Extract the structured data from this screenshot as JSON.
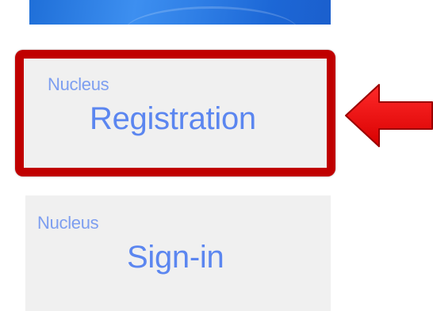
{
  "tiles": {
    "registration": {
      "brand": "Nucleus",
      "title": "Registration"
    },
    "signin": {
      "brand": "Nucleus",
      "title": "Sign-in"
    }
  },
  "colors": {
    "banner_blue": "#2f7fe6",
    "tile_bg": "#f0f0f0",
    "text_blue": "#5b86f0",
    "highlight_red": "#c00000",
    "arrow_red": "#ee0000"
  },
  "icons": {
    "pointer": "left-arrow-icon"
  }
}
